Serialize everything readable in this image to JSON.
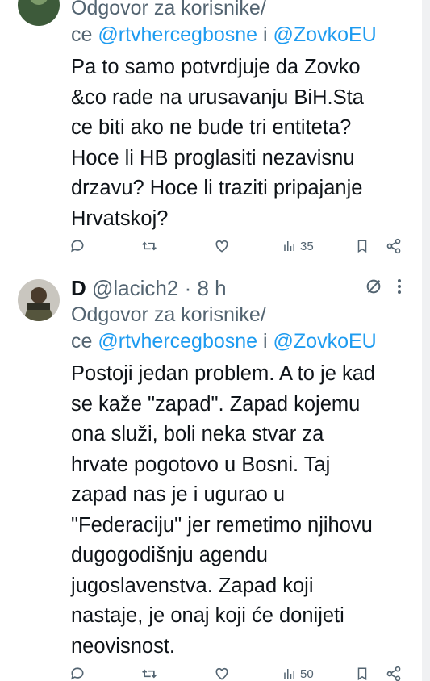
{
  "tweets": [
    {
      "reply_prefix": "Odgovor za korisnike/",
      "reply_line2_prefix": "ce ",
      "mention_1": "@rtvhercegbosne",
      "mention_join": " i ",
      "mention_2": "@ZovkoEU",
      "body_lines": [
        "Pa to samo potvrdjuje da Zovko",
        "&co rade na urusavanju BiH.Sta",
        "ce biti ako ne bude tri entiteta?",
        "Hoce li HB proglasiti nezavisnu",
        "drzavu? Hoce li traziti pripajanje",
        "Hrvatskoj?"
      ],
      "views": "35"
    },
    {
      "author_name": "D",
      "handle": "@lacich2",
      "separator": " · ",
      "time": "8 h",
      "reply_prefix": "Odgovor za korisnike/",
      "reply_line2_prefix": "ce ",
      "mention_1": "@rtvhercegbosne",
      "mention_join": " i ",
      "mention_2": "@ZovkoEU",
      "body_lines": [
        "Postoji jedan problem. A to je kad",
        "se kaže \"zapad\". Zapad kojemu",
        "ona služi, boli neka stvar za",
        "hrvate pogotovo u Bosni. Taj",
        "zapad nas je i ugurao u",
        "\"Federaciju\" jer remetimo njihovu",
        "dugogodišnju agendu",
        "jugoslavenstva. Zapad koji",
        "nastaje, je onaj koji će donijeti",
        "neovisnost."
      ],
      "views": "50"
    }
  ],
  "icons": {
    "reply": "reply-icon",
    "retweet": "retweet-icon",
    "like": "like-icon",
    "views": "views-icon",
    "bookmark": "bookmark-icon",
    "share": "share-icon",
    "grok": "grok-icon",
    "more": "more-icon"
  },
  "colors": {
    "text": "#0f1419",
    "secondary": "#536471",
    "mention": "#1d9bf0",
    "divider": "#e6e9eb"
  }
}
